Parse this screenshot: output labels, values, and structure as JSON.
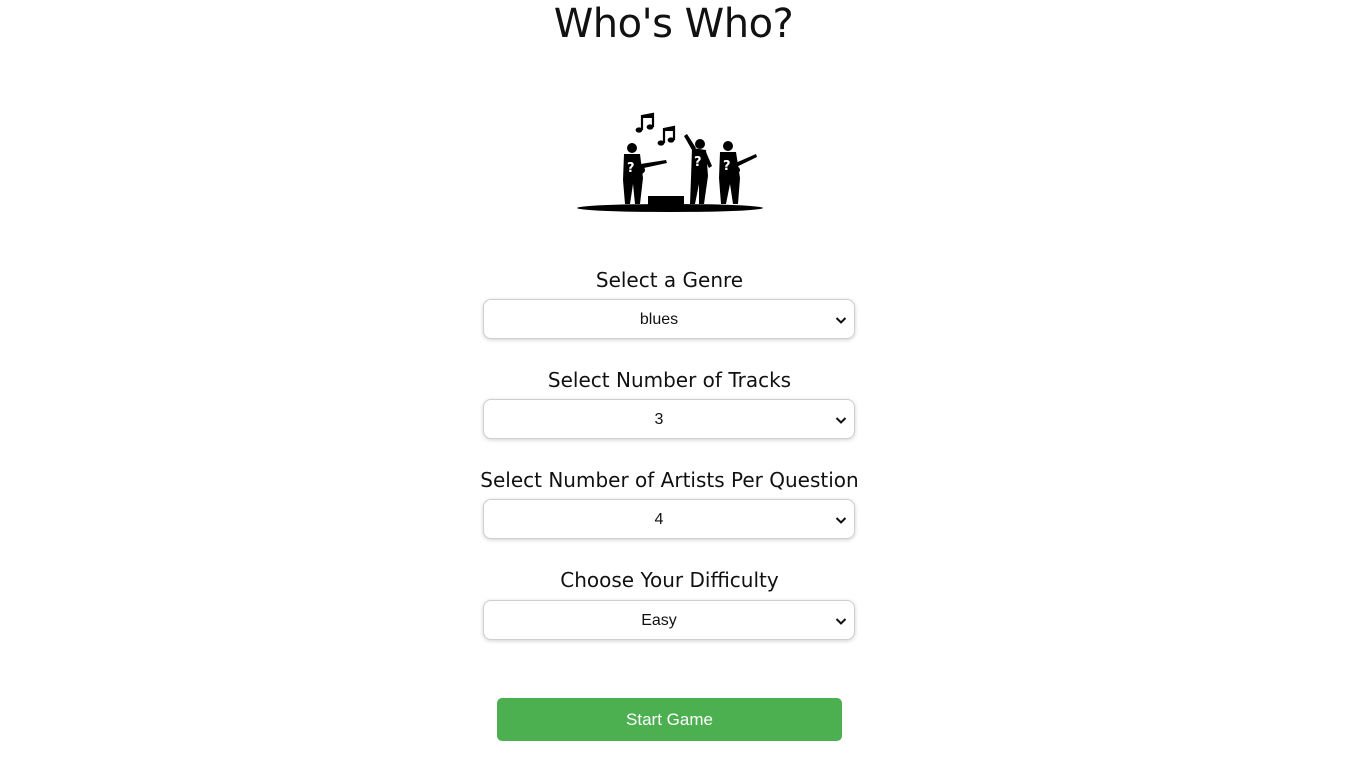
{
  "header": {
    "title": "Who's Who?"
  },
  "logo": {
    "icon": "band-silhouette-icon"
  },
  "form": {
    "genre": {
      "label": "Select a Genre",
      "value": "blues"
    },
    "tracks": {
      "label": "Select Number of Tracks",
      "value": "3"
    },
    "artists": {
      "label": "Select Number of Artists Per Question",
      "value": "4"
    },
    "difficulty": {
      "label": "Choose Your Difficulty",
      "value": "Easy"
    }
  },
  "actions": {
    "start_label": "Start Game",
    "start_color": "#4caf50"
  }
}
